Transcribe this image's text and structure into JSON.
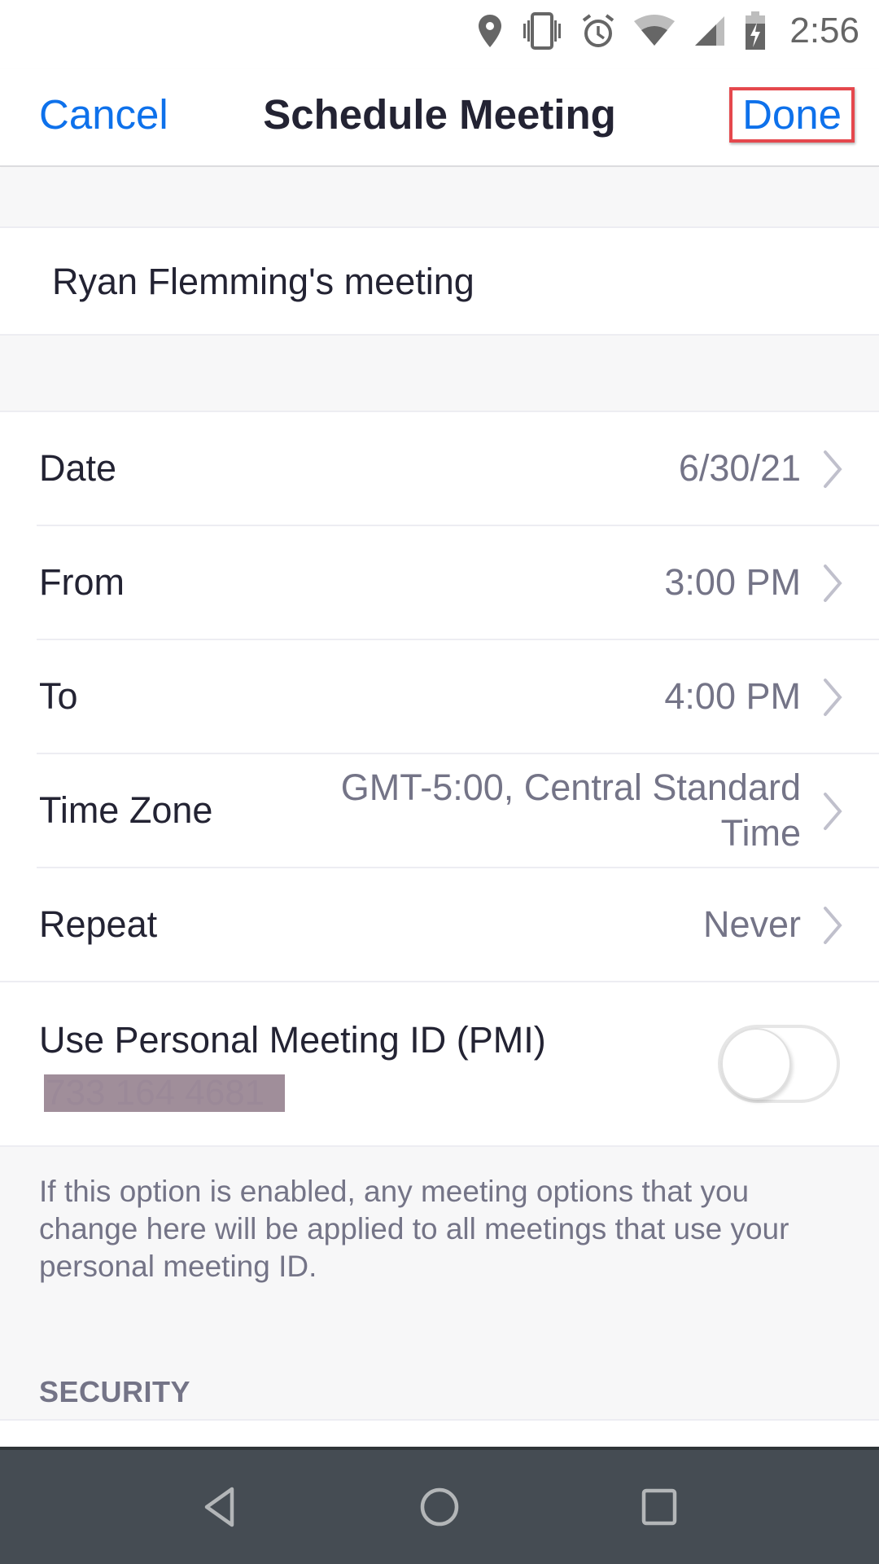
{
  "status_bar": {
    "time": "2:56",
    "icons": [
      "location-icon",
      "vibrate-icon",
      "alarm-icon",
      "wifi-icon",
      "cell-signal-icon",
      "battery-charging-icon"
    ]
  },
  "header": {
    "cancel_label": "Cancel",
    "title": "Schedule Meeting",
    "done_label": "Done",
    "done_highlight_color": "#e5484d"
  },
  "meeting": {
    "topic": "Ryan Flemming's meeting"
  },
  "settings": [
    {
      "label": "Date",
      "value": "6/30/21"
    },
    {
      "label": "From",
      "value": "3:00 PM"
    },
    {
      "label": "To",
      "value": "4:00 PM"
    },
    {
      "label": "Time Zone",
      "value": "GMT-5:00, Central Standard Time"
    },
    {
      "label": "Repeat",
      "value": "Never"
    }
  ],
  "pmi": {
    "label": "Use Personal Meeting ID (PMI)",
    "id": "733 164 4681",
    "enabled": false
  },
  "pmi_description": "If this option is enabled, any meeting options that you change here will be applied to all meetings that use your personal meeting ID.",
  "section_security": "SECURITY",
  "colors": {
    "accent": "#0e71eb",
    "text_primary": "#232333",
    "text_secondary": "#747487",
    "background_gray": "#f7f7f8",
    "nav_bar": "#454c53"
  },
  "nav_bar": {
    "buttons": [
      "back",
      "home",
      "recents"
    ]
  }
}
